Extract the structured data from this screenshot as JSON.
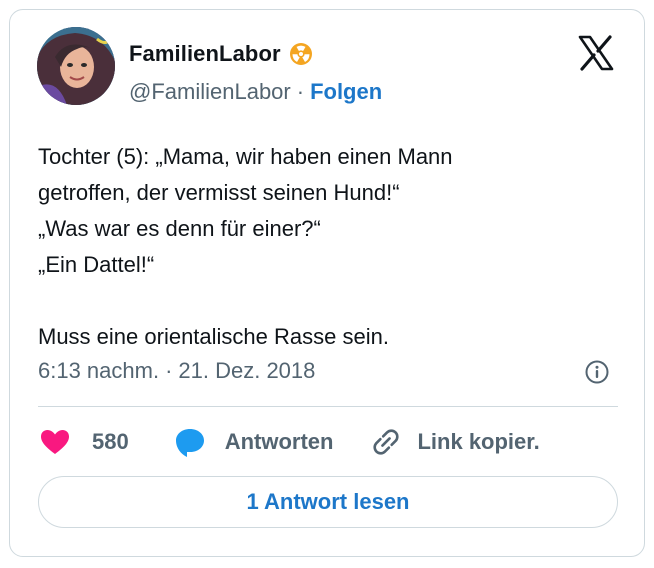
{
  "author": {
    "display_name": "FamilienLabor",
    "handle": "@FamilienLabor",
    "separator": "·",
    "follow_label": "Folgen"
  },
  "tweet": {
    "lines": [
      "Tochter (5): „Mama, wir haben einen Mann",
      "getroffen, der vermisst seinen Hund!“",
      "„Was war es denn für einer?“",
      "„Ein Dattel!“",
      "",
      "Muss eine orientalische Rasse sein."
    ],
    "time": "6:13 nachm.",
    "meta_separator": "·",
    "date": "21. Dez. 2018"
  },
  "actions": {
    "like_count": "580",
    "reply_label": "Antworten",
    "copy_label": "Link kopier."
  },
  "read_replies_label": "1 Antwort lesen",
  "colors": {
    "link_blue": "#1d77c9",
    "like_pink": "#f91880",
    "reply_blue": "#1d9bf0",
    "badge_orange": "#f4a521",
    "secondary_text": "#536471",
    "border": "#cfd9de"
  },
  "icons": {
    "badge": "radioactive-badge-icon",
    "logo": "x-logo-icon",
    "info": "info-icon",
    "like": "heart-icon",
    "reply": "speech-bubble-icon",
    "copy": "link-icon"
  }
}
